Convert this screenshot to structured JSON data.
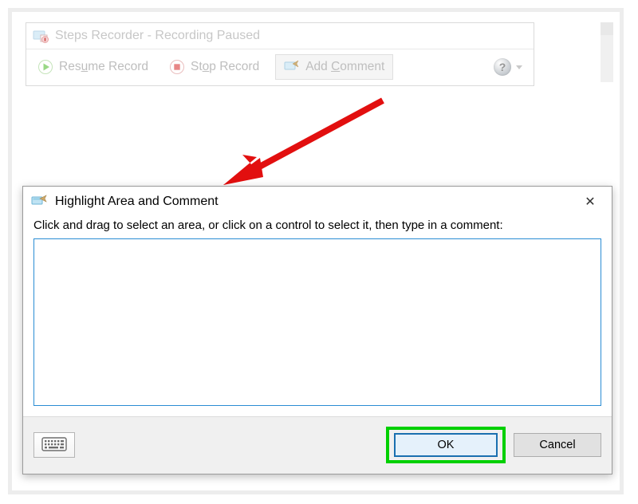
{
  "recorder": {
    "title": "Steps Recorder - Recording Paused",
    "resume_label_pre": "Res",
    "resume_label_u": "u",
    "resume_label_post": "me Record",
    "stop_label_pre": "St",
    "stop_label_u": "o",
    "stop_label_post": "p Record",
    "add_label_pre": "Add ",
    "add_label_u": "C",
    "add_label_post": "omment",
    "help_glyph": "?"
  },
  "dialog": {
    "title": "Highlight Area and Comment",
    "close_glyph": "✕",
    "instruction": "Click and drag to select an area, or click on a control to select it, then type in a comment:",
    "textarea_value": "",
    "ok_label": "OK",
    "cancel_label": "Cancel"
  }
}
